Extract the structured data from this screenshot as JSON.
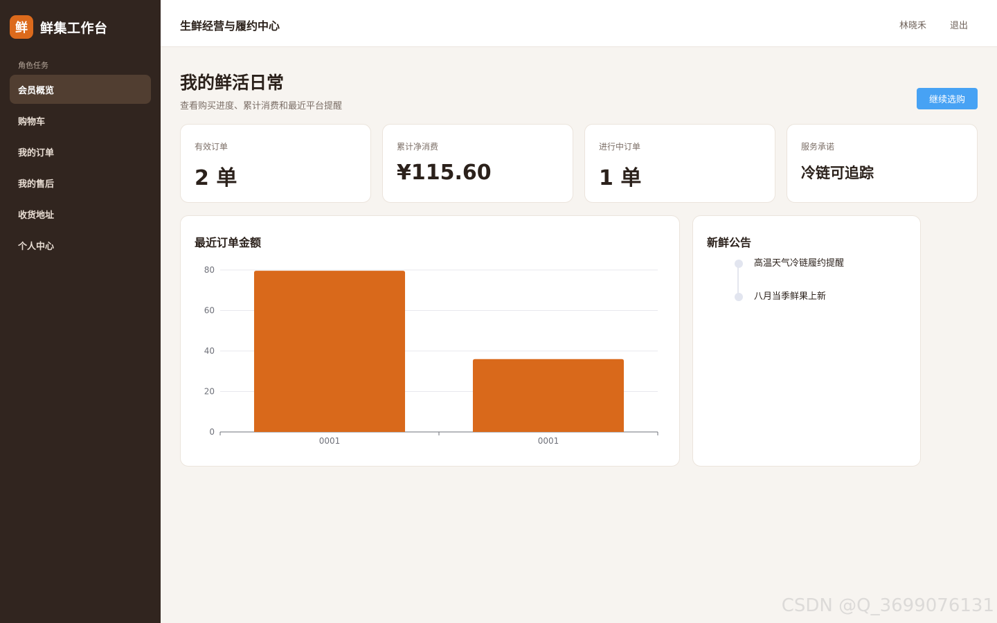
{
  "sidebar": {
    "logo_char": "鲜",
    "brand_name": "鲜集工作台",
    "section_label": "角色任务",
    "items": [
      {
        "label": "会员概览"
      },
      {
        "label": "购物车"
      },
      {
        "label": "我的订单"
      },
      {
        "label": "我的售后"
      },
      {
        "label": "收货地址"
      },
      {
        "label": "个人中心"
      }
    ]
  },
  "header": {
    "title": "生鲜经营与履约中心",
    "user": "林晓禾",
    "logout": "退出"
  },
  "page": {
    "title": "我的鲜活日常",
    "subtitle": "查看购买进度、累计消费和最近平台提醒",
    "primary_button": "继续选购"
  },
  "stats": [
    {
      "label": "有效订单",
      "value": "2 单"
    },
    {
      "label": "累计净消费",
      "value": "¥115.60"
    },
    {
      "label": "进行中订单",
      "value": "1 单"
    },
    {
      "label": "服务承诺",
      "value": "冷链可追踪"
    }
  ],
  "chart_card": {
    "title": "最近订单金额"
  },
  "chart_data": {
    "type": "bar",
    "title": "最近订单金额",
    "categories": [
      "0001",
      "0001"
    ],
    "values": [
      79.6,
      36
    ],
    "ylim": [
      0,
      80
    ],
    "yticks": [
      0,
      20,
      40,
      60,
      80
    ],
    "xlabel": "",
    "ylabel": "",
    "grid": true,
    "bar_color": "#d9691b"
  },
  "notices": {
    "title": "新鲜公告",
    "items": [
      {
        "text": "高温天气冷链履约提醒"
      },
      {
        "text": "八月当季鲜果上新"
      }
    ]
  },
  "watermark": "CSDN @Q_3699076131",
  "colors": {
    "sidebar_bg": "#31251f",
    "accent": "#dc6a1c",
    "primary_button": "#47a2f4",
    "active_nav": "#513e31"
  }
}
